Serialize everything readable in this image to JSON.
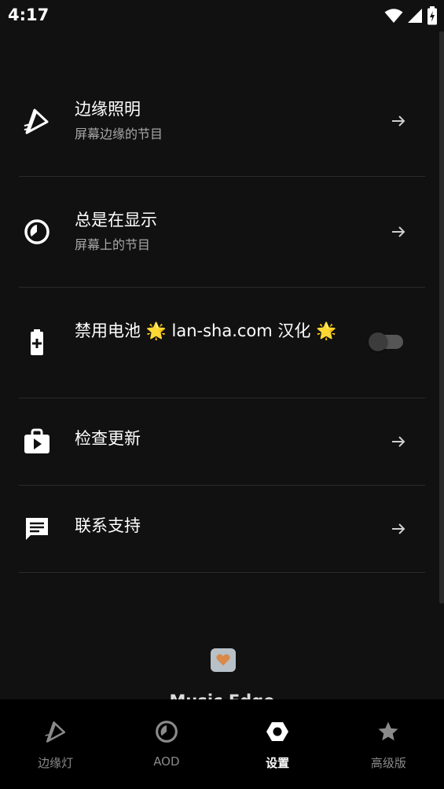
{
  "status_bar": {
    "time": "4:17",
    "icons": [
      "wifi-icon",
      "cell-signal-icon",
      "battery-charging-icon"
    ]
  },
  "settings": {
    "items": [
      {
        "title": "边缘照明",
        "subtitle": "屏幕边缘的节目",
        "icon": "edge-lighting-icon",
        "trailing": "arrow-right-icon"
      },
      {
        "title": "总是在显示",
        "subtitle": "屏幕上的节目",
        "icon": "aod-clock-icon",
        "trailing": "arrow-right-icon"
      },
      {
        "title": "禁用电池 🌟 lan-sha.com 汉化 🌟",
        "icon": "battery-icon",
        "trailing": "toggle",
        "toggle_on": false
      },
      {
        "title": "检查更新",
        "icon": "store-bag-icon",
        "trailing": "arrow-right-icon"
      },
      {
        "title": "联系支持",
        "icon": "chat-message-icon",
        "trailing": "arrow-right-icon"
      }
    ]
  },
  "footer": {
    "app_name": "Music Edge",
    "heart_icon": "heart-icon",
    "heart_color": "#d98a4a"
  },
  "bottom_nav": {
    "items": [
      {
        "label": "边缘灯",
        "icon": "edge-lighting-icon",
        "active": false
      },
      {
        "label": "AOD",
        "icon": "aod-clock-icon",
        "active": false
      },
      {
        "label": "设置",
        "icon": "settings-hex-icon",
        "active": true
      },
      {
        "label": "高级版",
        "icon": "star-icon",
        "active": false
      }
    ]
  },
  "colors": {
    "background": "#111111",
    "nav_background": "#000000",
    "divider": "#2b2b2b",
    "subtitle": "#a8a8a8",
    "inactive_nav": "#8a8a8a"
  }
}
